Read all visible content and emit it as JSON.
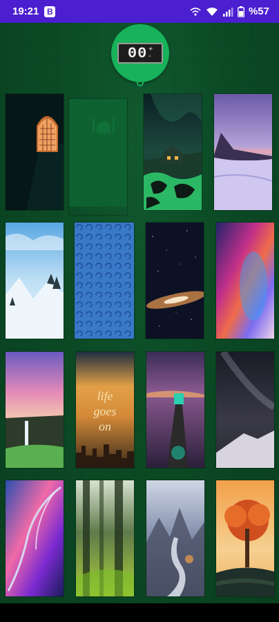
{
  "status_bar": {
    "time": "19:21",
    "notification_badge": "B",
    "battery_text": "%57",
    "icons": [
      "wifi-calling-icon",
      "wifi-icon",
      "signal-icon",
      "battery-icon"
    ]
  },
  "counter": {
    "digits": "00",
    "sign_top": "+",
    "sign_bottom": "-"
  },
  "wallpapers": [
    {
      "id": "mosque-window"
    },
    {
      "id": "green-mosque-overlay"
    },
    {
      "id": "aurora-cabin"
    },
    {
      "id": "purple-snow-mountain"
    },
    {
      "id": "snowy-trees"
    },
    {
      "id": "blue-swirl-pattern"
    },
    {
      "id": "galaxy"
    },
    {
      "id": "aurora-colors"
    },
    {
      "id": "waterfall-sunset"
    },
    {
      "id": "life-goes-on-city"
    },
    {
      "id": "lighthouse-pier"
    },
    {
      "id": "milky-way-mountain"
    },
    {
      "id": "gradient-feather"
    },
    {
      "id": "misty-forest"
    },
    {
      "id": "mountain-river"
    },
    {
      "id": "autumn-tree"
    }
  ],
  "wallpaper_text": {
    "life_goes_on": [
      "life",
      "goes",
      "on"
    ]
  },
  "colors": {
    "status_bar": "#4b1fd0",
    "background_green": "#0b4a25",
    "counter_green": "#17b25a"
  }
}
